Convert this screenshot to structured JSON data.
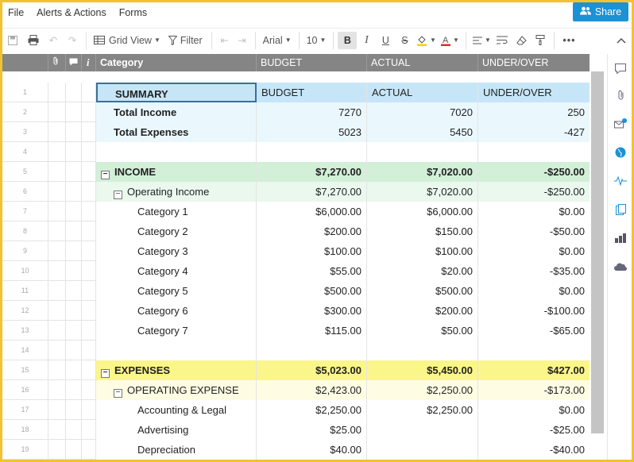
{
  "menu": [
    "File",
    "Alerts & Actions",
    "Forms"
  ],
  "share_label": "Share",
  "toolbar": {
    "grid_view": "Grid View",
    "filter": "Filter",
    "font": "Arial",
    "font_size": "10"
  },
  "columns": {
    "category": "Category",
    "budget": "BUDGET",
    "actual": "ACTUAL",
    "under_over": "UNDER/OVER"
  },
  "colors": {
    "accent": "#1b91d6",
    "frame": "#f2c230",
    "summary_blue": "#c6e6f8",
    "income_green": "#d2efd8",
    "income_sub_green": "#eaf8ee",
    "expense_yellow": "#fbf68a",
    "expense_sub_yellow": "#fefde4",
    "summary_light": "#eaf7fd"
  },
  "rows": [
    {
      "num": "1",
      "style": "summary-head",
      "category": "SUMMARY",
      "budget": "BUDGET",
      "actual": "ACTUAL",
      "under_over": "UNDER/OVER",
      "indent": 1
    },
    {
      "num": "2",
      "style": "summary",
      "category": "Total Income",
      "budget": "7270",
      "actual": "7020",
      "under_over": "250",
      "indent": 1
    },
    {
      "num": "3",
      "style": "summary",
      "category": "Total Expenses",
      "budget": "5023",
      "actual": "5450",
      "under_over": "-427",
      "indent": 1
    },
    {
      "num": "4",
      "style": "blank",
      "category": "",
      "budget": "",
      "actual": "",
      "under_over": "",
      "indent": 0
    },
    {
      "num": "5",
      "style": "income",
      "category": "INCOME",
      "budget": "$7,270.00",
      "actual": "$7,020.00",
      "under_over": "-$250.00",
      "indent": 0,
      "toggle": "−"
    },
    {
      "num": "6",
      "style": "income-sub",
      "category": "Operating Income",
      "budget": "$7,270.00",
      "actual": "$7,020.00",
      "under_over": "-$250.00",
      "indent": 1,
      "toggle": "−"
    },
    {
      "num": "7",
      "style": "plain",
      "category": "Category 1",
      "budget": "$6,000.00",
      "actual": "$6,000.00",
      "under_over": "$0.00",
      "indent": 2
    },
    {
      "num": "8",
      "style": "plain",
      "category": "Category 2",
      "budget": "$200.00",
      "actual": "$150.00",
      "under_over": "-$50.00",
      "indent": 2
    },
    {
      "num": "9",
      "style": "plain",
      "category": "Category 3",
      "budget": "$100.00",
      "actual": "$100.00",
      "under_over": "$0.00",
      "indent": 2
    },
    {
      "num": "10",
      "style": "plain",
      "category": "Category 4",
      "budget": "$55.00",
      "actual": "$20.00",
      "under_over": "-$35.00",
      "indent": 2
    },
    {
      "num": "11",
      "style": "plain",
      "category": "Category 5",
      "budget": "$500.00",
      "actual": "$500.00",
      "under_over": "$0.00",
      "indent": 2
    },
    {
      "num": "12",
      "style": "plain",
      "category": "Category 6",
      "budget": "$300.00",
      "actual": "$200.00",
      "under_over": "-$100.00",
      "indent": 2
    },
    {
      "num": "13",
      "style": "plain",
      "category": "Category 7",
      "budget": "$115.00",
      "actual": "$50.00",
      "under_over": "-$65.00",
      "indent": 2
    },
    {
      "num": "14",
      "style": "blank",
      "category": "",
      "budget": "",
      "actual": "",
      "under_over": "",
      "indent": 0
    },
    {
      "num": "15",
      "style": "expense",
      "category": "EXPENSES",
      "budget": "$5,023.00",
      "actual": "$5,450.00",
      "under_over": "$427.00",
      "indent": 0,
      "toggle": "−"
    },
    {
      "num": "16",
      "style": "expense-sub",
      "category": "OPERATING EXPENSE",
      "budget": "$2,423.00",
      "actual": "$2,250.00",
      "under_over": "-$173.00",
      "indent": 1,
      "toggle": "−"
    },
    {
      "num": "17",
      "style": "plain",
      "category": "Accounting & Legal",
      "budget": "$2,250.00",
      "actual": "$2,250.00",
      "under_over": "$0.00",
      "indent": 2
    },
    {
      "num": "18",
      "style": "plain",
      "category": "Advertising",
      "budget": "$25.00",
      "actual": "",
      "under_over": "-$25.00",
      "indent": 2
    },
    {
      "num": "19",
      "style": "plain",
      "category": "Depreciation",
      "budget": "$40.00",
      "actual": "",
      "under_over": "-$40.00",
      "indent": 2
    }
  ]
}
